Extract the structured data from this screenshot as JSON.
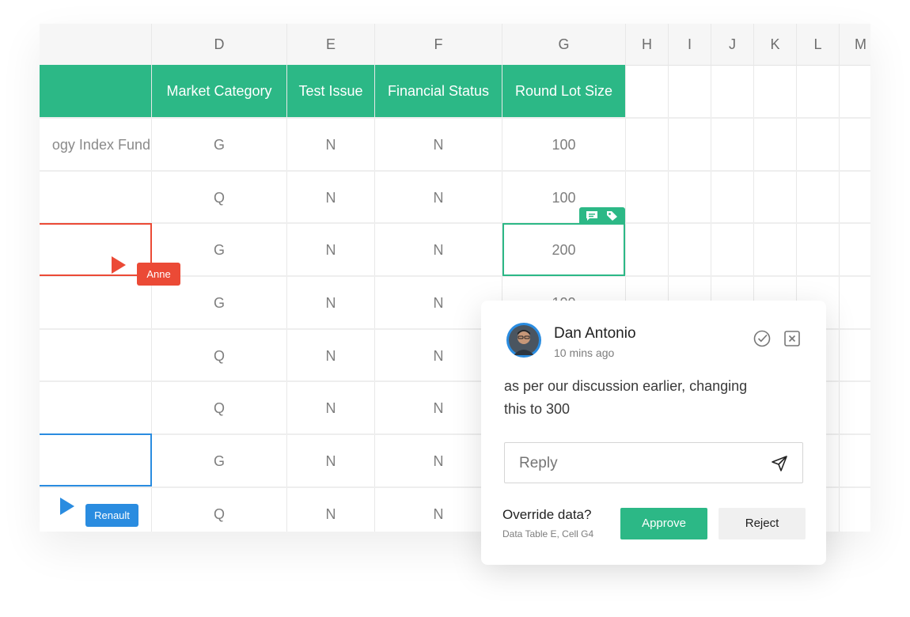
{
  "columns": [
    "D",
    "E",
    "F",
    "G",
    "H",
    "I",
    "J",
    "K",
    "L",
    "M"
  ],
  "table_headers": [
    "Market Category",
    "Test Issue",
    "Financial Status",
    "Round Lot Size"
  ],
  "rows": [
    {
      "name": "ogy Index Fund",
      "d": "G",
      "e": "N",
      "f": "N",
      "g": "100"
    },
    {
      "name": "",
      "d": "Q",
      "e": "N",
      "f": "N",
      "g": "100"
    },
    {
      "name": "",
      "d": "G",
      "e": "N",
      "f": "N",
      "g": "200"
    },
    {
      "name": "",
      "d": "G",
      "e": "N",
      "f": "N",
      "g": "100"
    },
    {
      "name": "",
      "d": "Q",
      "e": "N",
      "f": "N",
      "g": ""
    },
    {
      "name": "",
      "d": "Q",
      "e": "N",
      "f": "N",
      "g": ""
    },
    {
      "name": "",
      "d": "G",
      "e": "N",
      "f": "N",
      "g": ""
    },
    {
      "name": "",
      "d": "Q",
      "e": "N",
      "f": "N",
      "g": ""
    }
  ],
  "collaborators": [
    {
      "name": "Anne",
      "color": "#eb4a36"
    },
    {
      "name": "Renault",
      "color": "#2a8ce0"
    }
  ],
  "comment": {
    "author": "Dan Antonio",
    "time": "10 mins ago",
    "text_line1": "as per our discussion earlier, changing",
    "text_line2": "this to 300",
    "reply_placeholder": "Reply",
    "override_title": "Override data?",
    "override_sub": "Data Table E, Cell G4",
    "approve_label": "Approve",
    "reject_label": "Reject"
  },
  "colors": {
    "accent": "#2cb886",
    "anne": "#eb4a36",
    "renault": "#2a8ce0"
  },
  "icons": [
    "comment-icon",
    "tag-icon",
    "check-circle-icon",
    "close-box-icon",
    "send-icon",
    "avatar"
  ]
}
